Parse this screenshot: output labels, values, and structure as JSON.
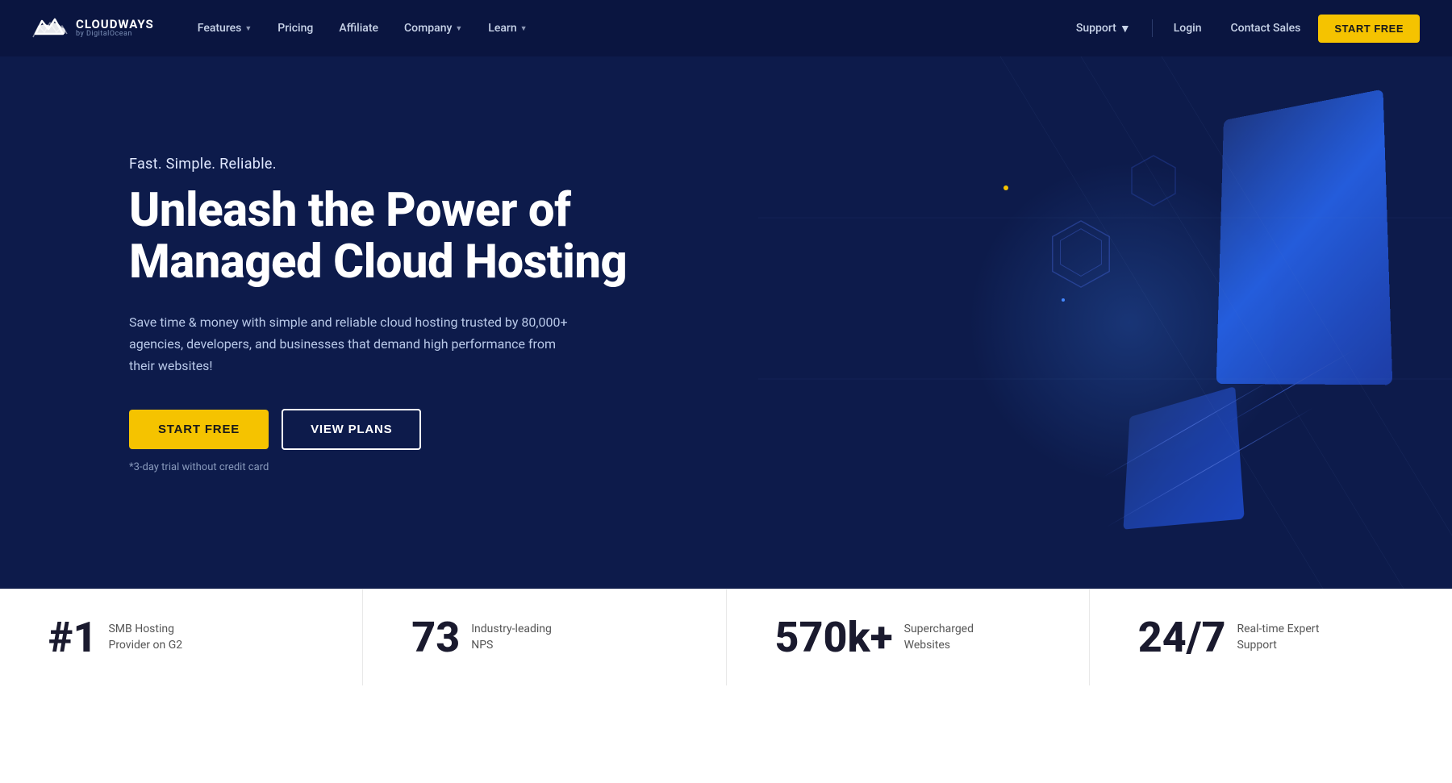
{
  "brand": {
    "name": "CLOUDWAYS",
    "sub": "by DigitalOcean",
    "logo_alt": "Cloudways logo"
  },
  "navbar": {
    "features_label": "Features",
    "pricing_label": "Pricing",
    "affiliate_label": "Affiliate",
    "company_label": "Company",
    "learn_label": "Learn",
    "support_label": "Support",
    "login_label": "Login",
    "contact_label": "Contact Sales",
    "start_free_label": "START FREE"
  },
  "hero": {
    "tagline": "Fast. Simple. Reliable.",
    "title": "Unleash the Power of Managed Cloud Hosting",
    "description": "Save time & money with simple and reliable cloud hosting trusted by 80,000+ agencies, developers, and businesses that demand high performance from their websites!",
    "btn_start": "START FREE",
    "btn_plans": "VIEW PLANS",
    "trial_note": "*3-day trial without credit card"
  },
  "stats": [
    {
      "number": "#1",
      "description": "SMB Hosting Provider on G2"
    },
    {
      "number": "73",
      "description": "Industry-leading NPS"
    },
    {
      "number": "570k+",
      "description": "Supercharged Websites"
    },
    {
      "number": "24/7",
      "description": "Real-time Expert Support"
    }
  ]
}
